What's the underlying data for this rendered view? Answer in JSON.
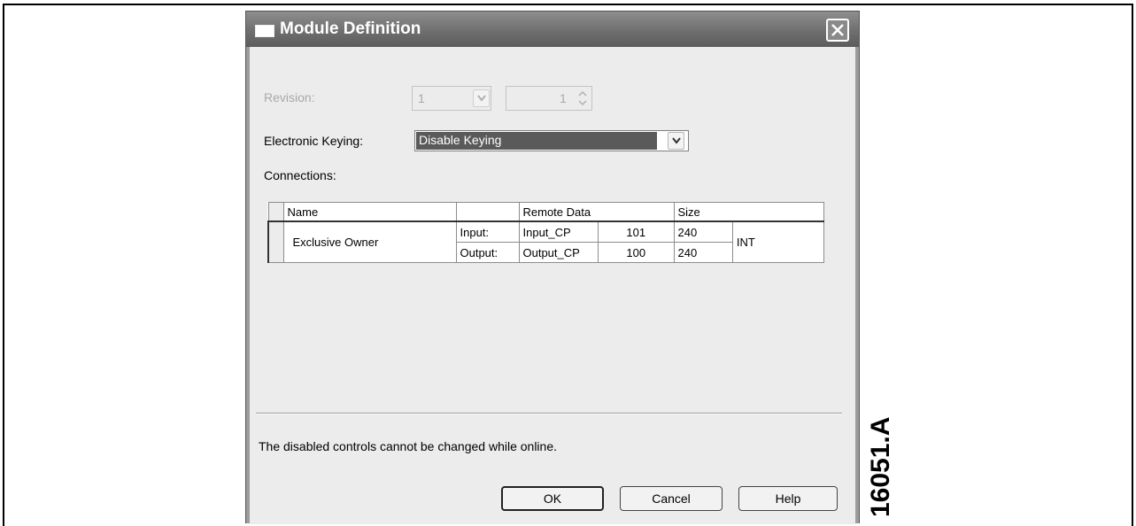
{
  "dialog": {
    "title": "Module Definition"
  },
  "revision": {
    "label": "Revision:",
    "major_value": "1",
    "minor_value": "1"
  },
  "electronic_keying": {
    "label": "Electronic Keying:",
    "selected": "Disable Keying"
  },
  "connections": {
    "label": "Connections:",
    "headers": [
      "Name",
      "",
      "Remote Data",
      "Size"
    ],
    "row": {
      "name": "Exclusive Owner",
      "input_label": "Input:",
      "input_tag": "Input_CP",
      "input_instance": "101",
      "input_size": "240",
      "output_label": "Output:",
      "output_tag": "Output_CP",
      "output_instance": "100",
      "output_size": "240",
      "data_type": "INT"
    }
  },
  "status_message": "The disabled controls cannot be changed while online.",
  "buttons": {
    "ok": "OK",
    "cancel": "Cancel",
    "help": "Help"
  },
  "figure_id": "16051.A"
}
